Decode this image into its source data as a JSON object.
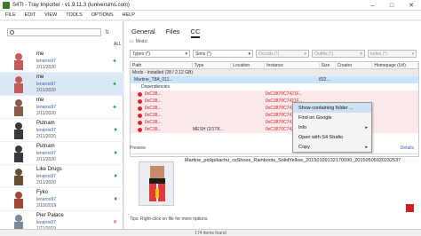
{
  "window": {
    "title": "S4TI - Tray Importer - v1.9.11.3 (luniversims.com)"
  },
  "menu": [
    "FILE",
    "EDIT",
    "VIEW",
    "TOOLS",
    "OPTIONS",
    "HELP"
  ],
  "sidebar": {
    "search_placeholder": "",
    "all_label": "ALL",
    "items": [
      {
        "name": "me",
        "creator": "lenarox97",
        "date": "2/11/2020",
        "icon": "green-leaf-icon",
        "selected": false
      },
      {
        "name": "me",
        "creator": "lenarox97",
        "date": "2/11/2020",
        "icon": "green-leaf-icon",
        "selected": true
      },
      {
        "name": "me",
        "creator": "lenarox97",
        "date": "2/11/2020",
        "icon": "green-leaf-icon",
        "selected": false
      },
      {
        "name": "Putnam",
        "creator": "lenarox97",
        "date": "2/11/2020",
        "icon": "yellow-green-icon",
        "selected": false
      },
      {
        "name": "Putnam",
        "creator": "lenarox97",
        "date": "2/11/2020",
        "icon": "yellow-green-icon",
        "selected": false
      },
      {
        "name": "Like Drugs",
        "creator": "lenarox97",
        "date": "2/11/2020",
        "icon": "yellow-green-icon",
        "selected": false
      },
      {
        "name": "Fyko",
        "creator": "lenarox97",
        "date": "2/10/2019",
        "icon": "yellow-green-icon",
        "selected": false
      },
      {
        "name": "Pier Palace",
        "creator": "lenarox97",
        "date": "1/11/2019",
        "icon": "red-x-icon",
        "selected": false
      }
    ]
  },
  "main": {
    "tabs": [
      {
        "label": "General",
        "active": false
      },
      {
        "label": "Files",
        "active": false
      },
      {
        "label": "CC",
        "active": true
      }
    ],
    "breadcrumb": "Mods\\",
    "filters": [
      {
        "label": "Types (*)",
        "disabled": false
      },
      {
        "label": "Sims (*)",
        "disabled": false
      },
      {
        "label": "Occults (*)",
        "disabled": true
      },
      {
        "label": "Outfits (*)",
        "disabled": true
      },
      {
        "label": "Index (*)",
        "disabled": true
      }
    ],
    "columns": [
      "Path",
      "Type",
      "Location",
      "Instance",
      "Size",
      "Creator",
      "Homepage (Url)"
    ],
    "group_label": "Mods - Installed (28 / 2.12 GB)",
    "rows": [
      {
        "path": "Martine_T8A_011...",
        "type": "",
        "location": "",
        "instance": "",
        "size": "832...",
        "selected": true,
        "dot": false
      },
      {
        "path": "Dependencies",
        "type": "",
        "location": "",
        "instance": "",
        "size": "",
        "selected": false,
        "dot": false
      },
      {
        "path": "0xC38...",
        "type": "",
        "location": "",
        "instance": "0xC3870C7421F...",
        "size": "",
        "selected": false,
        "dot": true
      },
      {
        "path": "0xC38...",
        "type": "",
        "location": "",
        "instance": "0xC3870C7421F...",
        "size": "",
        "selected": false,
        "dot": true
      },
      {
        "path": "0xC38...",
        "type": "",
        "location": "",
        "instance": "0xC3870C7421F...",
        "size": "",
        "selected": false,
        "dot": true
      },
      {
        "path": "0xC38...",
        "type": "",
        "location": "",
        "instance": "0xC3870C7421F...",
        "size": "",
        "selected": false,
        "dot": true
      },
      {
        "path": "0xC38...",
        "type": "",
        "location": "",
        "instance": "0xC3870C7421F...",
        "size": "",
        "selected": false,
        "dot": true
      },
      {
        "path": "0xC38...",
        "type": "MESH (2/1TK...",
        "location": "",
        "instance": "0xC3870C7421F...",
        "size": "",
        "selected": false,
        "dot": true
      }
    ],
    "context_menu": [
      {
        "label": "Show containing folder ...",
        "highlighted": true,
        "submenu": false
      },
      {
        "label": "Find on Google",
        "highlighted": false,
        "submenu": false
      },
      {
        "label": "Info",
        "highlighted": false,
        "submenu": true
      },
      {
        "label": "Open with S4 Studio",
        "highlighted": false,
        "submenu": false
      },
      {
        "label": "Copy",
        "highlighted": false,
        "submenu": true
      }
    ],
    "preview_label": "Preview",
    "details_label": "Details",
    "preview_filename": "Martine_pickpikachu_ccShoes_Rainboots_SolidYellow_20150109132170090_20150505020232537",
    "tips": "Tips: Right-click on file for more options."
  },
  "status": "174 items found",
  "colors": {
    "accent": "#3a5ea8",
    "selection": "#cce4fb",
    "danger": "#cc1f1f",
    "leaf": "#2d9b3b"
  }
}
